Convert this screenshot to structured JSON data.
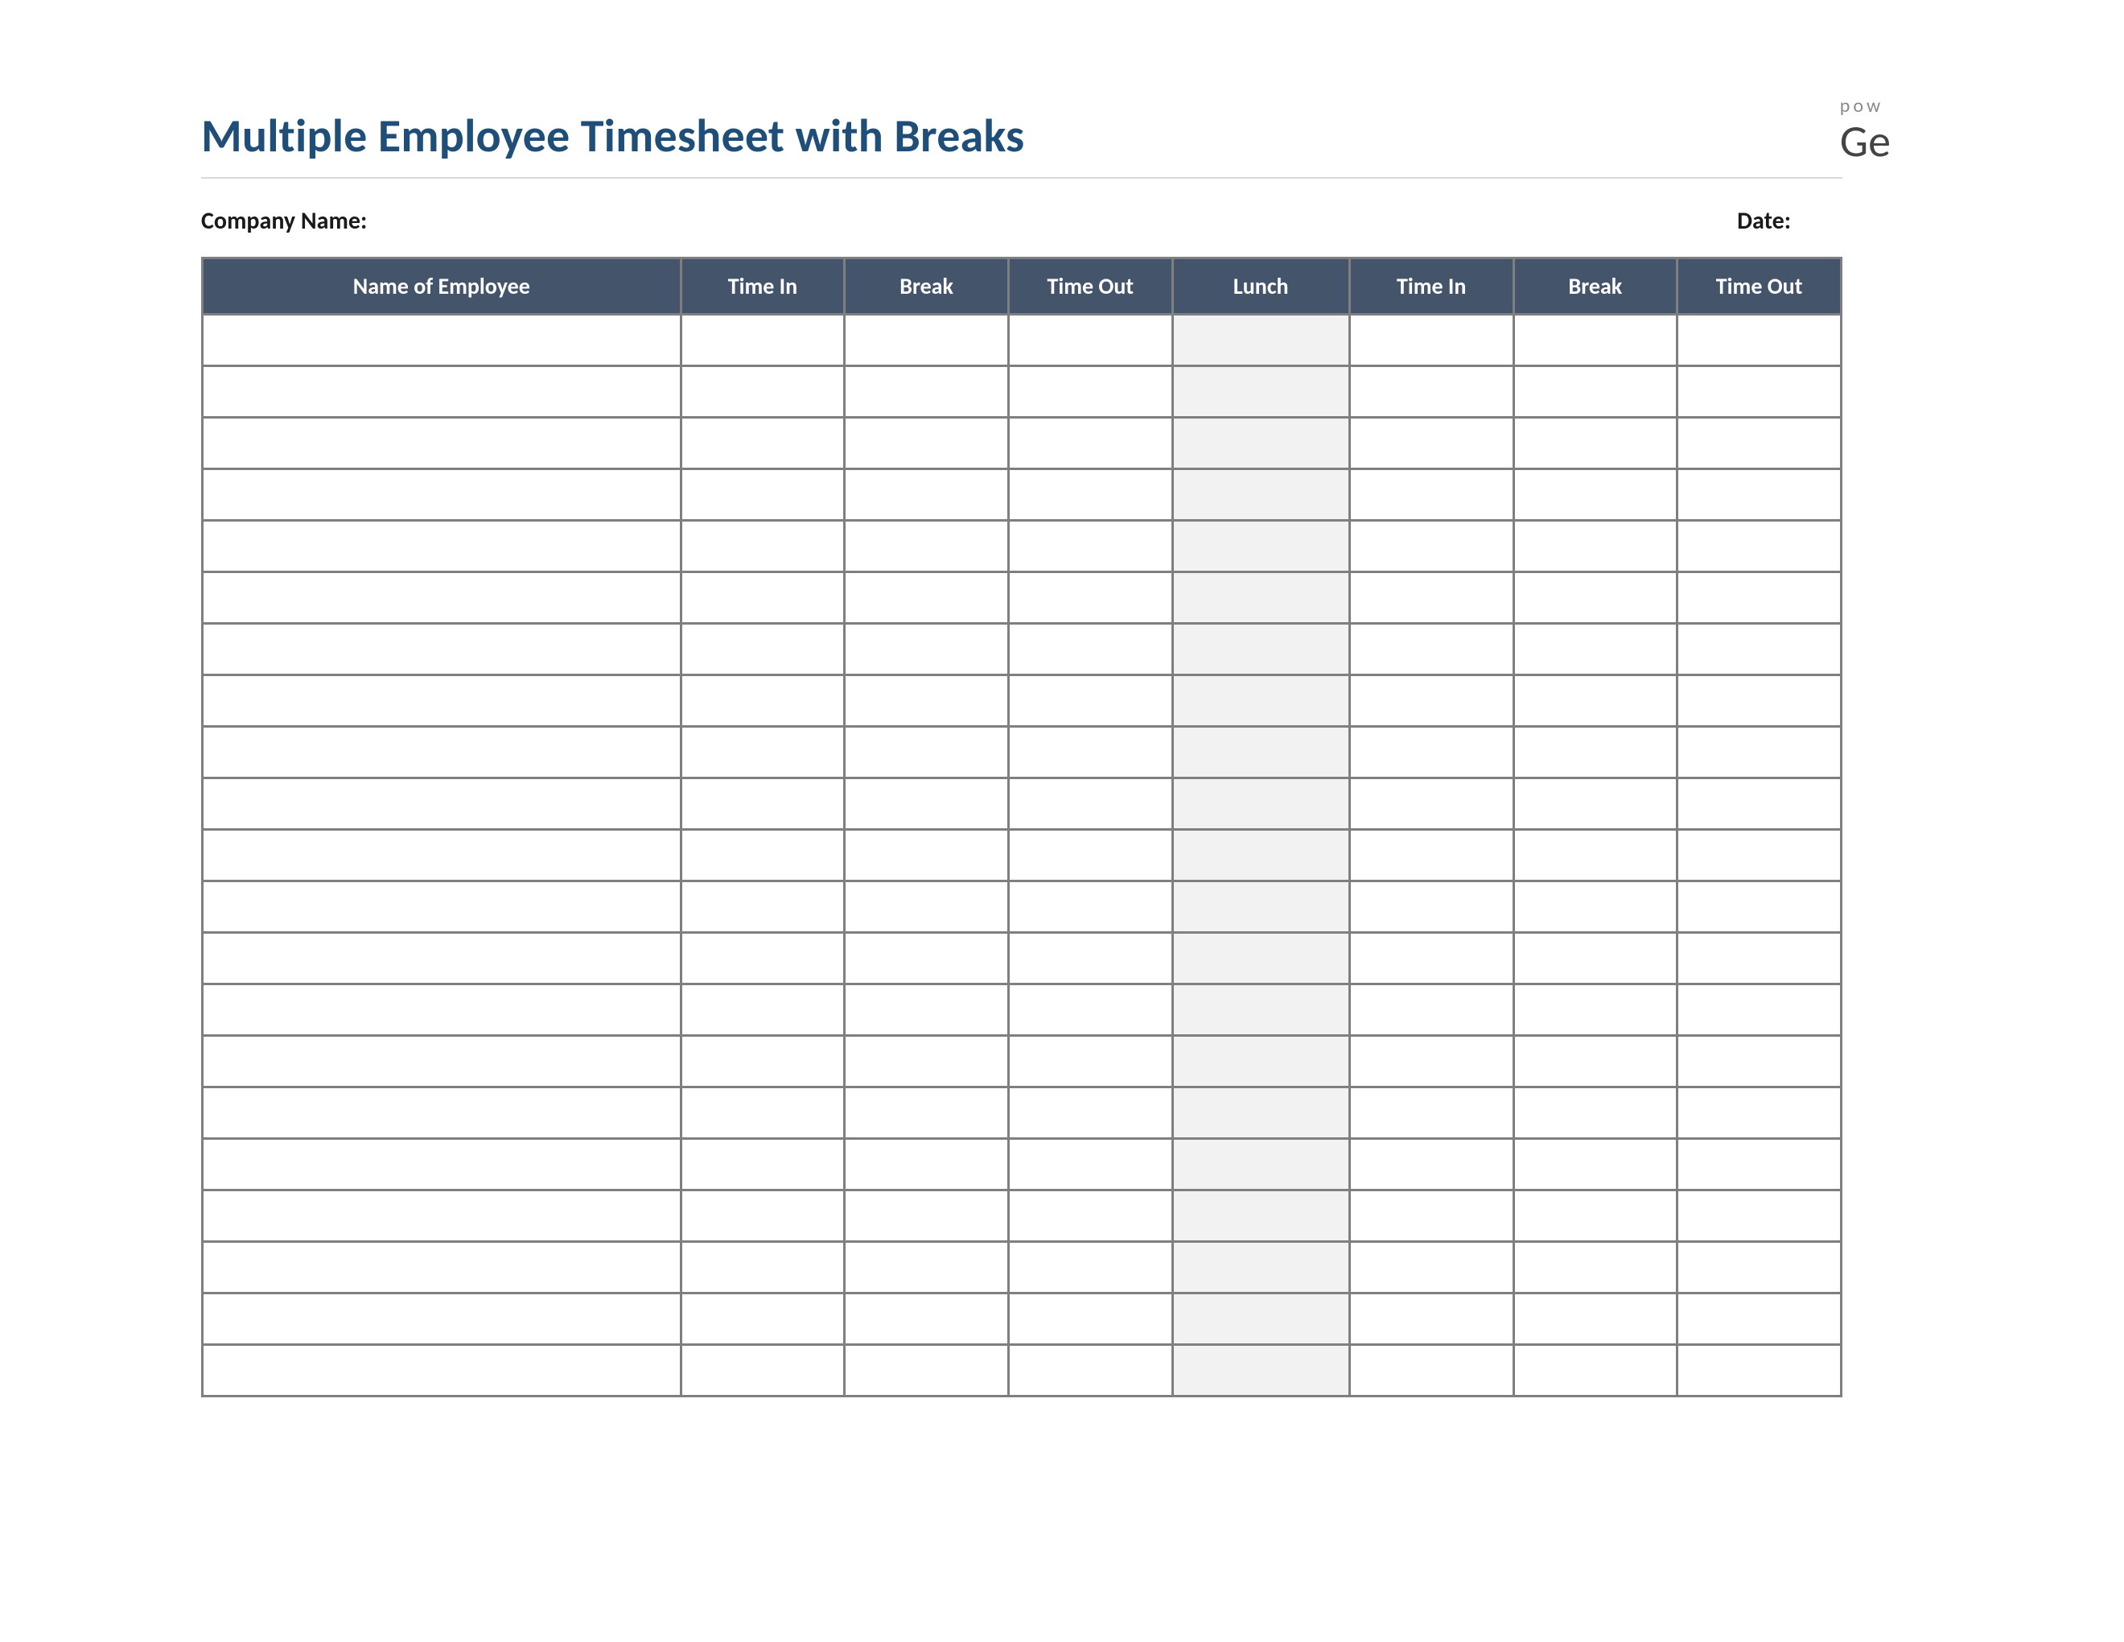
{
  "header": {
    "title": "Multiple Employee Timesheet with Breaks",
    "brand_top": "pow",
    "brand_main": "Ge"
  },
  "meta": {
    "company_label": "Company Name:",
    "date_label": "Date:"
  },
  "table": {
    "columns": [
      "Name of Employee",
      "Time In",
      "Break",
      "Time Out",
      "Lunch",
      "Time In",
      "Break",
      "Time Out"
    ],
    "row_count": 21,
    "shaded_column_index": 4
  }
}
